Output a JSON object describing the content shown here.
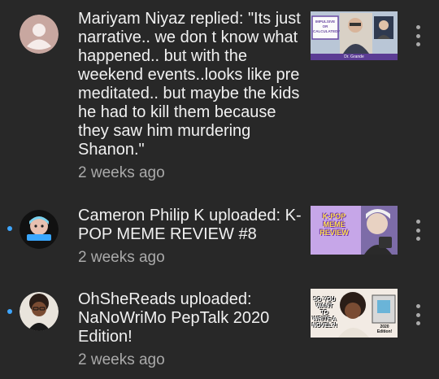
{
  "notifications": [
    {
      "text": "Mariyam Niyaz replied: \"Its just narrative.. we don t know what happened.. but with the weekend events..looks like pre meditated.. but maybe the kids he had to kill them because they saw him murdering Shanon.\"",
      "time": "2 weeks ago",
      "unread": false,
      "avatar": "default-user-avatar",
      "thumbnail": {
        "caption_1": "IMPULSIVE OR CALCULATED?",
        "caption_2": "Dr. Grande"
      }
    },
    {
      "text": "Cameron Philip K uploaded: K-POP MEME REVIEW #8",
      "time": "2 weeks ago",
      "unread": true,
      "avatar": "channel-avatar-cameron",
      "thumbnail": {
        "caption_1": "K-POP MEME REVIEW"
      }
    },
    {
      "text": "OhSheReads uploaded: NaNoWriMo PepTalk 2020 Edition!",
      "time": "2 weeks ago",
      "unread": true,
      "avatar": "channel-avatar-ohshereads",
      "thumbnail": {
        "caption_1": "SO YOU WANT TO WRITE A NOVEL?!",
        "caption_2": "2020 Edition!"
      }
    }
  ],
  "colors": {
    "background": "#282828",
    "text": "#f1f1f1",
    "secondary_text": "#aaaaaa",
    "unread_dot": "#3ea6ff"
  },
  "icons": {
    "menu": "more-vert-icon"
  }
}
